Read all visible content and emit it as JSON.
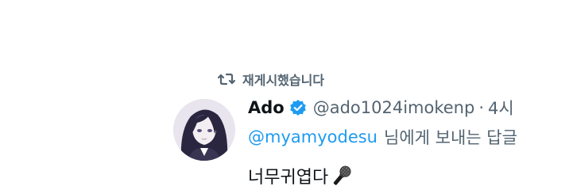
{
  "retweet": {
    "label": "재게시했습니다",
    "icon": "retweet-icon"
  },
  "author": {
    "display_name": "Ado",
    "verified": true,
    "verified_icon": "verified-badge-icon",
    "handle": "@ado1024imokenp",
    "separator": "·",
    "time": "4시"
  },
  "reply": {
    "mention": "@myamyodesu",
    "suffix": "님에게 보내는 답글"
  },
  "body": {
    "text": "너무귀엽다",
    "emoji": "microphone-icon"
  },
  "colors": {
    "text_primary": "#0f1419",
    "text_secondary": "#536471",
    "accent": "#1d9bf0"
  }
}
